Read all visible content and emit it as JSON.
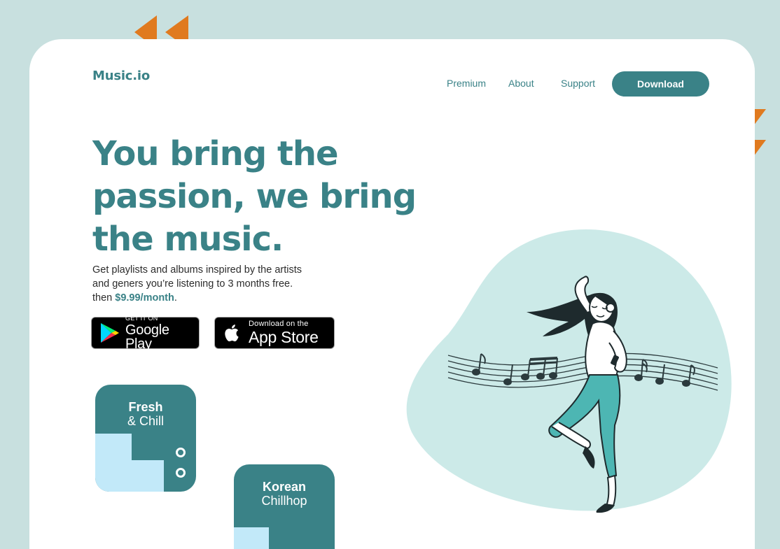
{
  "brand": {
    "logo": "Music.io"
  },
  "nav": {
    "links": [
      "Premium",
      "About",
      "Support"
    ],
    "download_label": "Download"
  },
  "hero": {
    "title_lines": [
      "You bring the",
      "passion, we bring",
      "the music."
    ],
    "sub_line1": "Get playlists and albums inspired by the artists",
    "sub_line2": "and geners you’re listening to 3 months free.",
    "sub_line3_prefix": "then ",
    "price": "$9.99/month",
    "sub_line3_suffix": "."
  },
  "stores": {
    "google": {
      "small": "GET IT ON",
      "big": "Google Play"
    },
    "apple": {
      "small": "Download on the",
      "big": "App Store"
    }
  },
  "playlists": [
    {
      "title": "Fresh",
      "subtitle": "& Chill"
    },
    {
      "title": "Korean",
      "subtitle": "Chillhop"
    }
  ],
  "colors": {
    "background": "#c8e0df",
    "brand": "#3a8287",
    "accent": "#e07a1f",
    "blob": "#cceae8",
    "playlist_block": "#c2e9f9"
  },
  "icons": [
    "rewind-arrows-icon",
    "down-arrows-icon",
    "google-play-icon",
    "apple-icon",
    "music-notes-icon"
  ]
}
